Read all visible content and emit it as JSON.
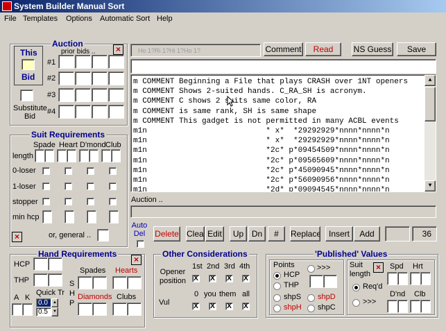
{
  "window": {
    "title": "System Builder Manual Sort"
  },
  "menu": [
    "File",
    "Templates",
    "Options",
    "Automatic Sort",
    "Help"
  ],
  "auction": {
    "title": "Auction",
    "this_bid_top": "This",
    "this_bid_bottom": "Bid",
    "prior_bids": "prior bids ..",
    "rows": [
      "#1",
      "#2",
      "#3",
      "#4"
    ],
    "substitute_bid": "Substitute Bid"
  },
  "toolbar": {
    "hidden_text": "Ho 1?Ri 1?Hi 1?Ho 1?",
    "comment": "Comment",
    "read": "Read",
    "ns_guess": "NS Guess",
    "save": "Save"
  },
  "listing": {
    "lines": [
      "m COMMENT Beginning a File that plays CRASH over 1NT openers",
      "m COMMENT Shows 2-suited hands. C_RA_SH is acronym.",
      "m COMMENT C shows 2 suits same color, RA",
      "m COMMENT is same rank, SH is same shape",
      "m COMMENT This gadget is not permitted in many ACBL events",
      "m1n                          * x*  *29292929*nnnn*nnnn*n",
      "m1n                          * x*  *29292929*nnnn*nnnn*n",
      "m1n                          *2c* p*09454509*nnnn*nnnn*n",
      "m1n                          *2c* p*09565609*nnnn*nnnn*n",
      "m1n                          *2c* p*45090945*nnnn*nnnn*n",
      "m1n                          *2c* p*56090956*nnnn*nnnn*n",
      "m1n                          *2d* p*09094545*nnnn*nnnn*n"
    ]
  },
  "auction_bar": {
    "label": "Auction .."
  },
  "suit_req": {
    "title": "Suit Requirements",
    "cols": [
      "Spade",
      "Heart",
      "D'mond",
      "Club"
    ],
    "rows": [
      "length",
      "0-loser",
      "1-loser",
      "stopper",
      "min hcp"
    ],
    "or_general": "or, general .."
  },
  "actions": {
    "auto_del": "Auto Del",
    "delete": "Delete",
    "clear": "Clear",
    "edit": "Edit",
    "up": "Up",
    "dn": "Dn",
    "hash": "#",
    "replace": "Replace",
    "insert": "Insert",
    "add": "Add",
    "count": "36"
  },
  "hand_req": {
    "title": "Hand Requirements",
    "hcp": "HCP",
    "thp": "THP",
    "a": "A",
    "k": "K",
    "quick_tr": "Quick Tr",
    "qt_values": [
      "0.0",
      "0.5"
    ],
    "shp": [
      "S",
      "H",
      "P"
    ],
    "spades": "Spades",
    "hearts": "Hearts",
    "diamonds": "Diamonds",
    "clubs": "Clubs"
  },
  "other": {
    "title": "Other Considerations",
    "positions": [
      "1st",
      "2nd",
      "3rd",
      "4th"
    ],
    "opener_position": "Opener position",
    "vul_cols": [
      "0",
      "you",
      "them",
      "all"
    ],
    "vul": "Vul",
    "mark": "X"
  },
  "published": {
    "title": "'Published' Values",
    "points": "Points",
    "more": ">>>",
    "hcp": "HCP",
    "thp": "THP",
    "shps": "shpS",
    "shpd": "shpD",
    "shph": "shpH",
    "shpc": "shpC",
    "suit_length": "Suit length",
    "reqd": "Req'd",
    "more2": ">>>",
    "spd": "Spd",
    "hrt": "Hrt",
    "dnd": "D'nd",
    "clb": "Clb"
  },
  "colors": {
    "accent_red": "#c00000",
    "title_blue": "#00008b"
  }
}
